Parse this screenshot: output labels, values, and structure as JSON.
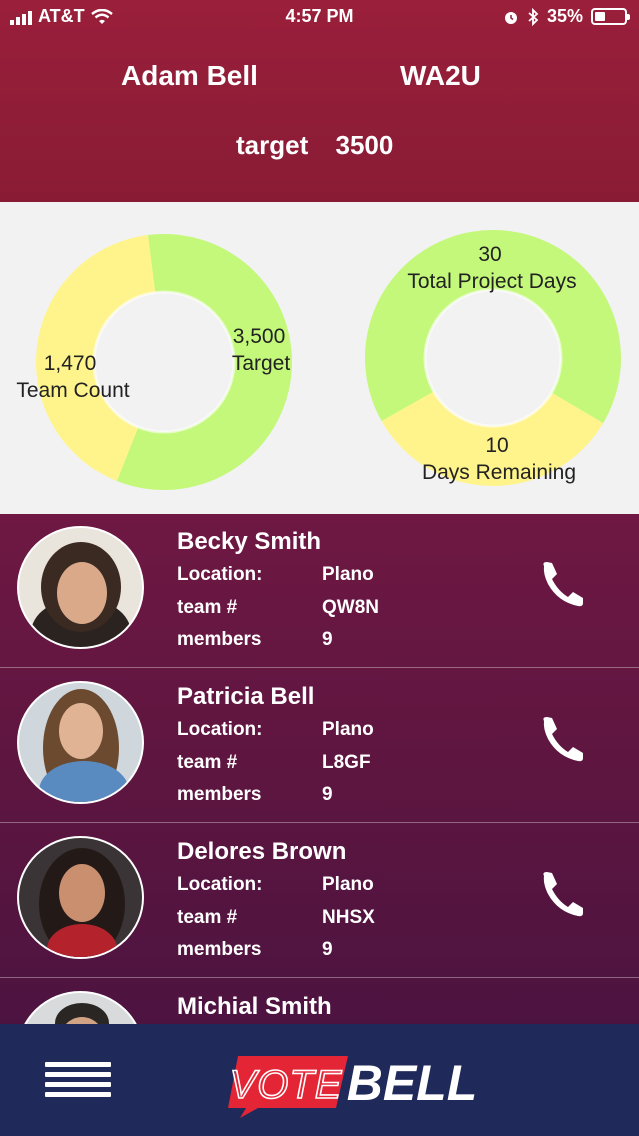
{
  "status_bar": {
    "carrier": "AT&T",
    "time": "4:57 PM",
    "battery_percent": "35%",
    "battery_level": 0.35
  },
  "header": {
    "user_name": "Adam Bell",
    "user_code": "WA2U",
    "target_label": "target",
    "target_value": "3500"
  },
  "charts": {
    "team": {
      "count_value": "1,470",
      "count_label": "Team Count",
      "target_value": "3,500",
      "target_label": "Target",
      "count_fraction": 0.42,
      "colors": {
        "count": "#fff48c",
        "target": "#c4f87a"
      }
    },
    "days": {
      "total_value": "30",
      "total_label": "Total Project Days",
      "remaining_value": "10",
      "remaining_label": "Days Remaining",
      "remaining_fraction": 0.333,
      "colors": {
        "remaining": "#fff48c",
        "total": "#c4f87a"
      }
    }
  },
  "members": [
    {
      "name": "Becky Smith",
      "location_label": "Location:",
      "location": "Plano",
      "team_label": "team #",
      "team": "QW8N",
      "members_label": "members",
      "members": "9"
    },
    {
      "name": "Patricia Bell",
      "location_label": "Location:",
      "location": "Plano",
      "team_label": "team #",
      "team": "L8GF",
      "members_label": "members",
      "members": "9"
    },
    {
      "name": "Delores Brown",
      "location_label": "Location:",
      "location": "Plano",
      "team_label": "team #",
      "team": "NHSX",
      "members_label": "members",
      "members": "9"
    },
    {
      "name": "Michial Smith"
    }
  ],
  "footer": {
    "logo_vote": "VOTE",
    "logo_bell": "BELL",
    "menu_icon": "hamburger-menu-icon"
  }
}
